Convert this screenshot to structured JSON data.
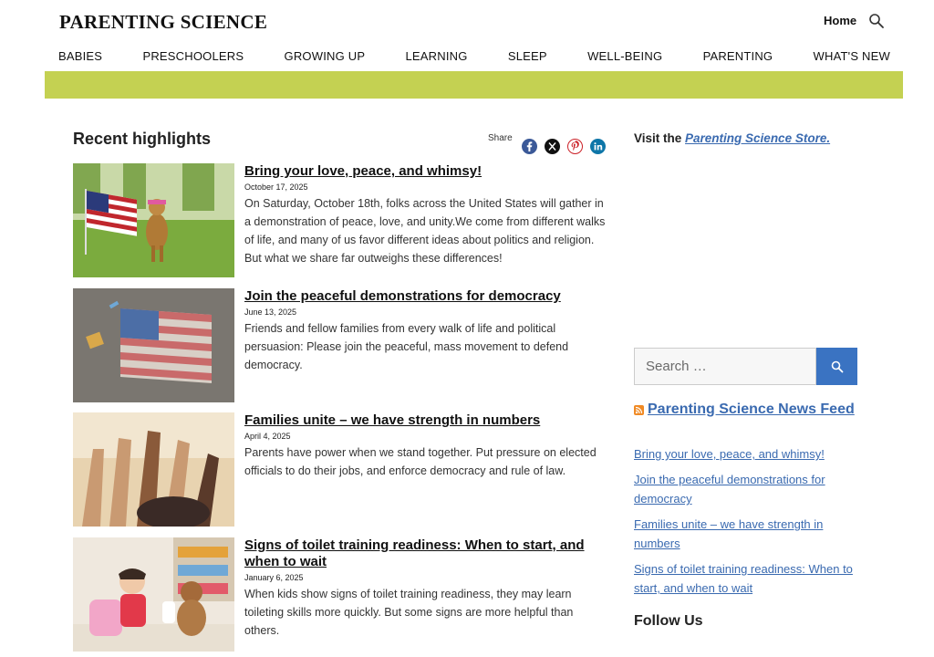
{
  "header": {
    "logo": "PARENTING SCIENCE",
    "home_label": "Home",
    "search_icon": "search-icon"
  },
  "nav": [
    "BABIES",
    "PRESCHOOLERS",
    "GROWING UP",
    "LEARNING",
    "SLEEP",
    "WELL-BEING",
    "PARENTING",
    "WHAT'S NEW"
  ],
  "banner_color": "#c4d152",
  "main": {
    "section_title": "Recent highlights",
    "share_label": "Share",
    "share_icons": [
      "facebook-icon",
      "x-icon",
      "pinterest-icon",
      "linkedin-icon"
    ],
    "articles": [
      {
        "title": "Bring your love, peace, and whimsy!",
        "date": "October 17, 2025",
        "excerpt": "On Saturday, October 18th, folks across the United States will gather in a demonstration of peace, love, and unity.We come from different walks of life, and many of us favor different ideas about politics and religion. But what we share far outweighs these differences!"
      },
      {
        "title": "Join the peaceful demonstrations for democracy",
        "date": "June 13, 2025",
        "excerpt": "Friends and fellow families from every walk of life and political persuasion: Please join the peaceful, mass movement to defend democracy."
      },
      {
        "title": "Families unite – we have strength in numbers",
        "date": "April 4, 2025",
        "excerpt": "Parents have power when we stand together. Put pressure on elected officials to do their jobs, and enforce democracy and rule of law."
      },
      {
        "title": "Signs of toilet training readiness: When to start, and when to wait",
        "date": "January 6, 2025",
        "excerpt": "When kids show signs of toilet training readiness, they may learn toileting skills more quickly. But some signs are more helpful than others."
      }
    ]
  },
  "sidebar": {
    "store_prefix": "Visit the ",
    "store_link": "Parenting Science Store.",
    "search_placeholder": "Search …",
    "feed_title": "Parenting Science News Feed",
    "feed_items": [
      "Bring your love, peace, and whimsy!",
      "Join the peaceful demonstrations for democracy",
      "Families unite – we have strength in numbers",
      "Signs of toilet training readiness: When to start, and when to wait"
    ],
    "follow_title": "Follow Us"
  },
  "colors": {
    "link": "#3a6ab0",
    "search_button": "#3a73c2",
    "facebook": "#3b5998",
    "pinterest": "#cb2027",
    "linkedin": "#0e76a8"
  }
}
